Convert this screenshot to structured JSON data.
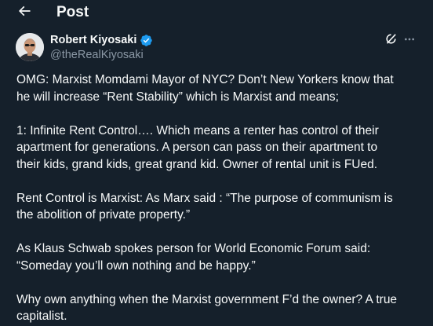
{
  "header": {
    "title": "Post",
    "back_icon": "arrow-left-icon"
  },
  "author": {
    "name": "Robert Kiyosaki",
    "handle": "@theRealKiyosaki",
    "verified": true,
    "verified_color": "#1d9bf0"
  },
  "actions": {
    "grok_icon": "grok-icon",
    "more_icon": "more-horizontal-icon"
  },
  "tweet": {
    "paragraphs": [
      "OMG:  Marxist Momdami Mayor of NYC?  Don’t New Yorkers know that\nhe will increase “Rent Stability”  which is Marxist and means;",
      "1:  Infinite Rent Control…. Which means a renter has control of their\napartment for generations.  A person can pass on their apartment to\ntheir kids, grand kids, great grand kid.  Owner of rental unit is FUed.",
      "Rent Control is Marxist:  As Marx said : “The purpose of communism is\nthe abolition of private property.”",
      "As Klaus Schwab spokes person for World Economic Forum said:\n“Someday you’ll own nothing and be happy.”",
      "Why own anything when the Marxist government F’d the owner? A true\ncapitalist."
    ]
  },
  "colors": {
    "background": "#15202b",
    "text": "#f7f9f9",
    "secondary_text": "#8b98a5"
  }
}
